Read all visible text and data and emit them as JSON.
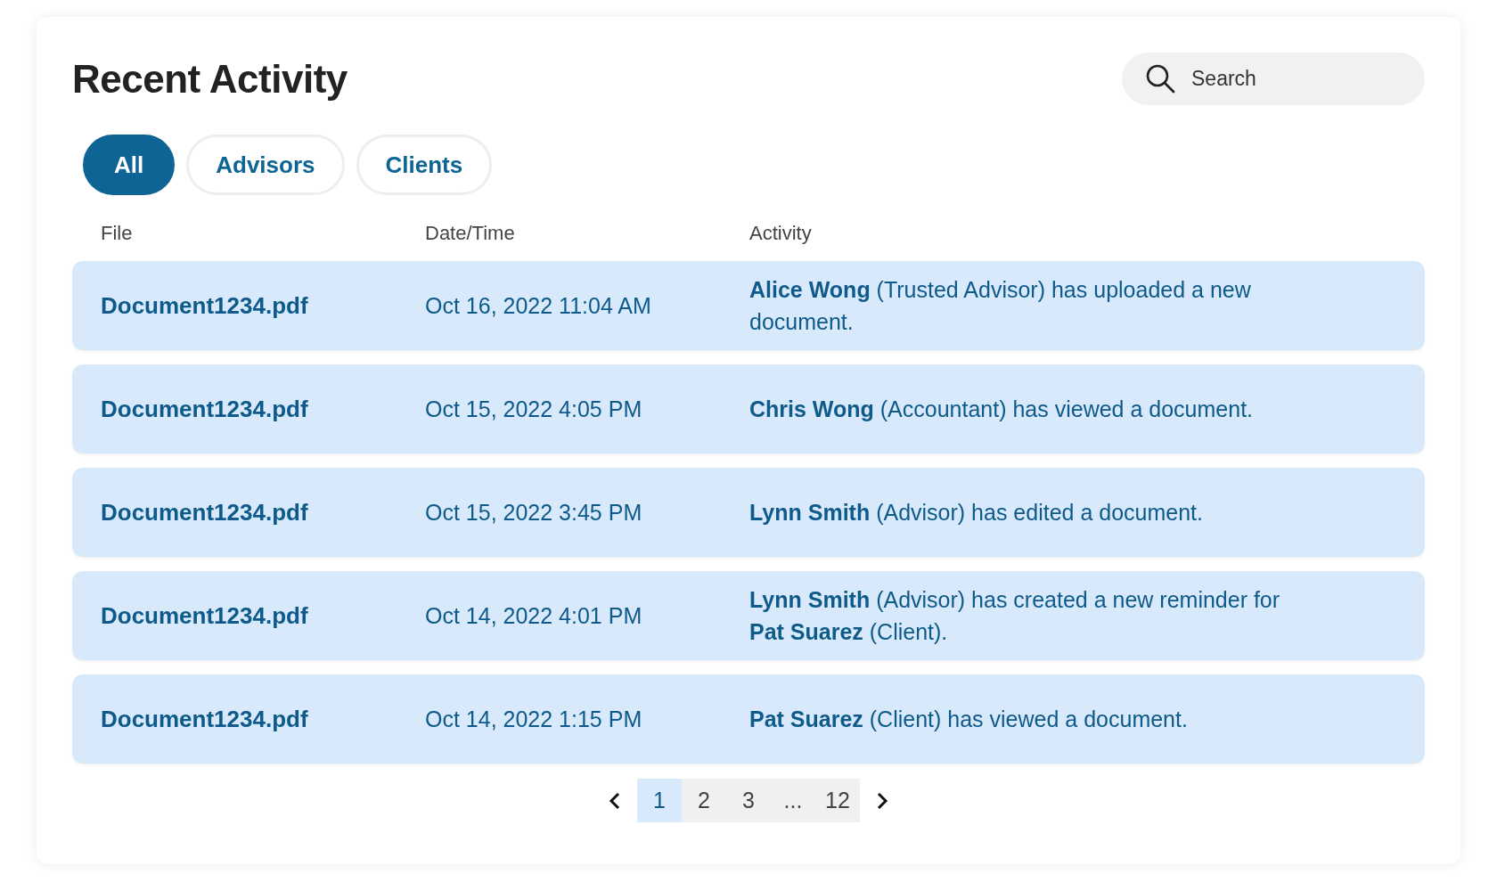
{
  "title": "Recent Activity",
  "search": {
    "placeholder": "Search"
  },
  "tabs": [
    {
      "label": "All",
      "selected": true
    },
    {
      "label": "Advisors",
      "selected": false
    },
    {
      "label": "Clients",
      "selected": false
    }
  ],
  "table": {
    "columns": [
      "File",
      "Date/Time",
      "Activity"
    ],
    "rows": [
      {
        "file": "Document1234.pdf",
        "datetime": "Oct 16, 2022 11:04 AM",
        "activity": "**Alice Wong** (Trusted Advisor) has uploaded a new document."
      },
      {
        "file": "Document1234.pdf",
        "datetime": "Oct 15, 2022 4:05 PM",
        "activity": "**Chris Wong** (Accountant) has viewed a document."
      },
      {
        "file": "Document1234.pdf",
        "datetime": "Oct 15, 2022 3:45 PM",
        "activity": "**Lynn Smith** (Advisor) has edited a document."
      },
      {
        "file": "Document1234.pdf",
        "datetime": "Oct 14, 2022 4:01 PM",
        "activity": "**Lynn Smith** (Advisor) has created a new reminder for **Pat Suarez** (Client)."
      },
      {
        "file": "Document1234.pdf",
        "datetime": "Oct 14, 2022 1:15 PM",
        "activity": "**Pat Suarez** (Client) has viewed a document."
      }
    ]
  },
  "pagination": {
    "pages": [
      {
        "label": "1",
        "selected": true
      },
      {
        "label": "2",
        "selected": false
      },
      {
        "label": "3",
        "selected": false
      },
      {
        "label": "...",
        "selected": false
      },
      {
        "label": "12",
        "selected": false
      }
    ]
  }
}
